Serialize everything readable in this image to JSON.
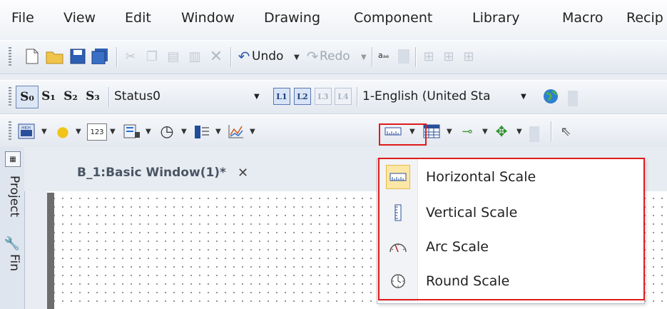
{
  "menu": [
    "File",
    "View",
    "Edit",
    "Window",
    "Drawing",
    "Component",
    "Library",
    "Macro",
    "Recip"
  ],
  "toolbar1": {
    "undo_label": "Undo",
    "redo_label": "Redo",
    "text_icon_label": "aₐₑ"
  },
  "toolbar2": {
    "state_buttons": [
      "S₀",
      "S₁",
      "S₂",
      "S₃"
    ],
    "status_value": "Status0",
    "layer_buttons": [
      "L1",
      "L2",
      "L3",
      "L4"
    ],
    "language_value": "1-English (United Sta"
  },
  "document_tab": {
    "title": "B_1:Basic Window(1)*",
    "close": "✕"
  },
  "sidebar": {
    "project_tab": "Project",
    "find_tab": "Fin"
  },
  "dropdown": {
    "items": [
      {
        "label": "Horizontal Scale",
        "icon": "horizontal-scale-icon",
        "selected": true
      },
      {
        "label": "Vertical Scale",
        "icon": "vertical-scale-icon",
        "selected": false
      },
      {
        "label": "Arc Scale",
        "icon": "arc-scale-icon",
        "selected": false
      },
      {
        "label": "Round Scale",
        "icon": "round-scale-icon",
        "selected": false
      }
    ]
  },
  "colors": {
    "highlight_red": "#e01b1b",
    "selected_item_bg": "#fde7a6"
  }
}
